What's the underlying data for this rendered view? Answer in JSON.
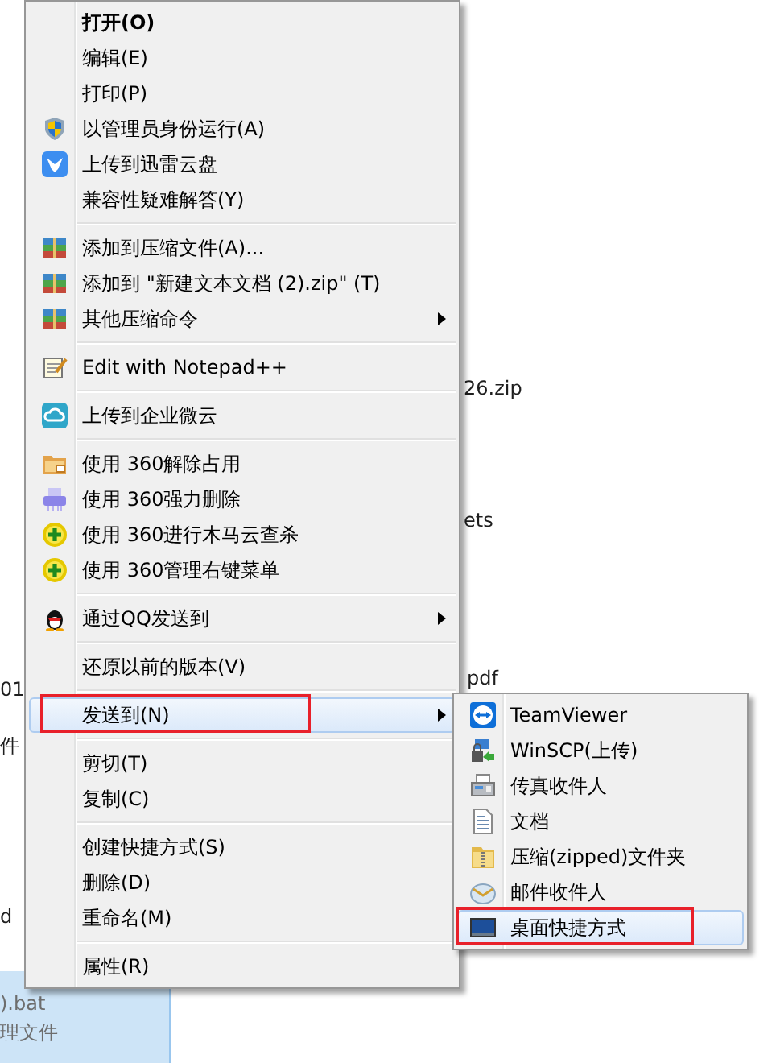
{
  "background_files": [
    {
      "text": "26.zip",
      "selected": false
    },
    {
      "text": "ets",
      "selected": false
    },
    {
      "text": "01",
      "selected": false
    },
    {
      "text": "pdf",
      "selected": false
    },
    {
      "text": "件",
      "selected": false
    },
    {
      "text": "d",
      "selected": false
    },
    {
      "text": ").bat",
      "selected": true
    },
    {
      "text": "理文件",
      "selected": true
    }
  ],
  "context_menu": {
    "items": [
      {
        "kind": "item",
        "label": "打开(O)",
        "bold": true,
        "selected": false
      },
      {
        "kind": "item",
        "label": "编辑(E)",
        "selected": false
      },
      {
        "kind": "item",
        "label": "打印(P)",
        "selected": false
      },
      {
        "kind": "item",
        "label": "以管理员身份运行(A)",
        "selected": false
      },
      {
        "kind": "item",
        "label": "上传到迅雷云盘",
        "selected": false
      },
      {
        "kind": "item",
        "label": "兼容性疑难解答(Y)",
        "selected": false
      },
      {
        "kind": "separator"
      },
      {
        "kind": "item",
        "label": "添加到压缩文件(A)...",
        "selected": false
      },
      {
        "kind": "item",
        "label": "添加到 \"新建文本文档 (2).zip\" (T)",
        "selected": false
      },
      {
        "kind": "item",
        "label": "其他压缩命令",
        "submenu": true,
        "selected": false
      },
      {
        "kind": "separator"
      },
      {
        "kind": "item",
        "label": "Edit with Notepad++",
        "selected": false
      },
      {
        "kind": "separator"
      },
      {
        "kind": "item",
        "label": "上传到企业微云",
        "selected": false
      },
      {
        "kind": "separator"
      },
      {
        "kind": "item",
        "label": "使用 360解除占用",
        "selected": false
      },
      {
        "kind": "item",
        "label": "使用 360强力删除",
        "selected": false
      },
      {
        "kind": "item",
        "label": "使用 360进行木马云查杀",
        "selected": false
      },
      {
        "kind": "item",
        "label": "使用 360管理右键菜单",
        "selected": false
      },
      {
        "kind": "separator"
      },
      {
        "kind": "item",
        "label": "通过QQ发送到",
        "submenu": true,
        "selected": false
      },
      {
        "kind": "separator"
      },
      {
        "kind": "item",
        "label": "还原以前的版本(V)",
        "selected": false
      },
      {
        "kind": "separator"
      },
      {
        "kind": "item",
        "label": "发送到(N)",
        "submenu": true,
        "selected": true,
        "annotated": true
      },
      {
        "kind": "separator"
      },
      {
        "kind": "item",
        "label": "剪切(T)",
        "selected": false
      },
      {
        "kind": "item",
        "label": "复制(C)",
        "selected": false
      },
      {
        "kind": "separator"
      },
      {
        "kind": "item",
        "label": "创建快捷方式(S)",
        "selected": false
      },
      {
        "kind": "item",
        "label": "删除(D)",
        "selected": false
      },
      {
        "kind": "item",
        "label": "重命名(M)",
        "selected": false
      },
      {
        "kind": "separator"
      },
      {
        "kind": "item",
        "label": "属性(R)",
        "selected": false
      }
    ]
  },
  "send_to_menu": {
    "items": [
      {
        "label": "TeamViewer",
        "selected": false
      },
      {
        "label": "WinSCP(上传)",
        "selected": false
      },
      {
        "label": "传真收件人",
        "selected": false
      },
      {
        "label": "文档",
        "selected": false
      },
      {
        "label": "压缩(zipped)文件夹",
        "selected": false
      },
      {
        "label": "邮件收件人",
        "selected": false
      },
      {
        "label": "桌面快捷方式",
        "selected": true,
        "annotated": true
      }
    ]
  }
}
